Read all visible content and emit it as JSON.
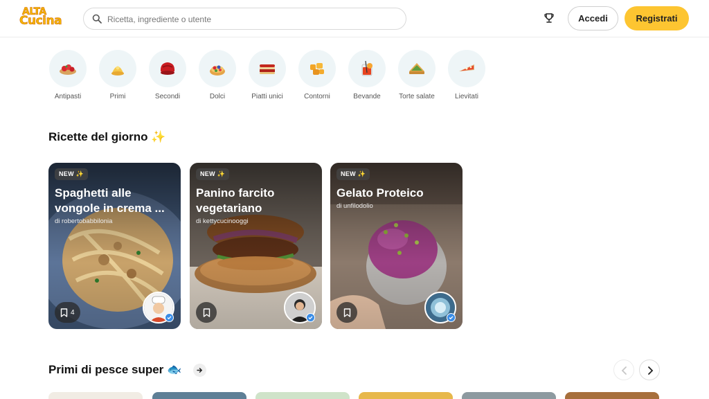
{
  "header": {
    "logo_line1": "ALTA",
    "logo_line2": "Cucina",
    "search_placeholder": "Ricetta, ingrediente o utente",
    "login_label": "Accedi",
    "register_label": "Registrati"
  },
  "categories": [
    {
      "label": "Antipasti",
      "icon": "bruschetta-icon"
    },
    {
      "label": "Primi",
      "icon": "pasta-icon"
    },
    {
      "label": "Secondi",
      "icon": "meat-icon"
    },
    {
      "label": "Dolci",
      "icon": "tart-icon"
    },
    {
      "label": "Piatti unici",
      "icon": "lasagna-icon"
    },
    {
      "label": "Contorni",
      "icon": "potatoes-icon"
    },
    {
      "label": "Bevande",
      "icon": "cocktail-icon"
    },
    {
      "label": "Torte salate",
      "icon": "quiche-icon"
    },
    {
      "label": "Lievitati",
      "icon": "pizza-slice-icon"
    }
  ],
  "section1": {
    "title": "Ricette del giorno ✨",
    "cards": [
      {
        "badge": "NEW ✨",
        "title": "Spaghetti alle vongole in crema ...",
        "author": "di robertobabbilonia",
        "saves": "4"
      },
      {
        "badge": "NEW ✨",
        "title": "Panino farcito vegetariano",
        "author": "di kettycucinooggi",
        "saves": ""
      },
      {
        "badge": "NEW ✨",
        "title": "Gelato Proteico",
        "author": "di unfilodolio",
        "saves": ""
      }
    ]
  },
  "section2": {
    "title": "Primi di pesce super 🐟"
  },
  "colors": {
    "accent": "#fdc531",
    "logo": "#f5b700",
    "category_bg": "#eef5f7",
    "verified": "#3b8de6"
  }
}
